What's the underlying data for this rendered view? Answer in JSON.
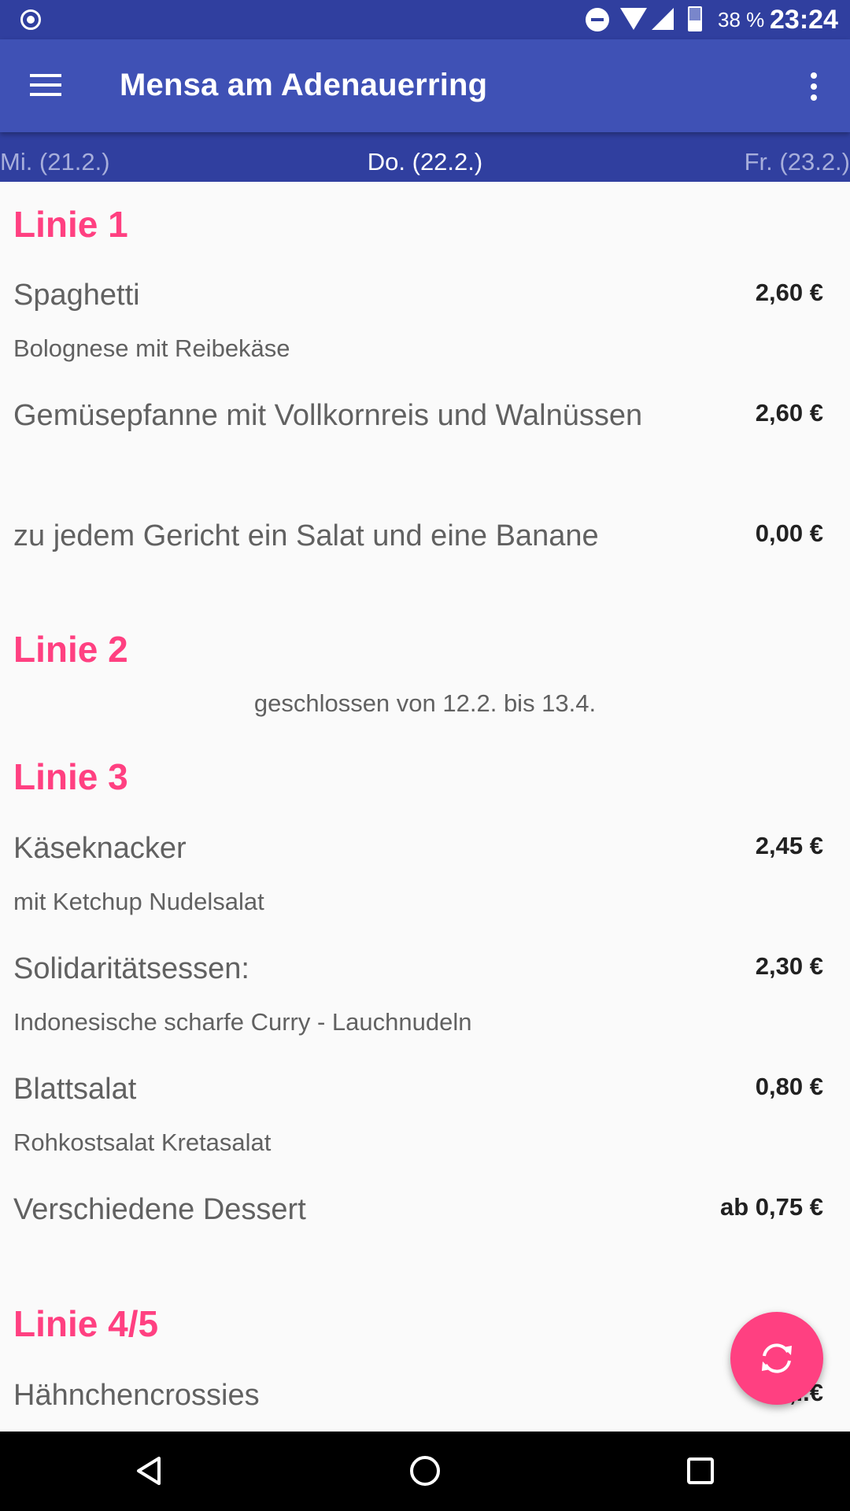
{
  "statusbar": {
    "battery": "38 %",
    "time": "23:24",
    "icons": [
      "record-icon",
      "do-not-disturb-icon",
      "wifi-icon",
      "signal-icon",
      "battery-icon"
    ]
  },
  "appbar": {
    "title": "Mensa am Adenauerring",
    "menu_icon": "hamburger-menu-icon",
    "overflow_icon": "more-vert-icon"
  },
  "days": {
    "prev": "Mi. (21.2.)",
    "current": "Do. (22.2.)",
    "next": "Fr. (23.2.)"
  },
  "lines": [
    {
      "title": "Linie 1",
      "meals": [
        {
          "name": "Spaghetti",
          "desc": "Bolognese mit Reibekäse",
          "price": "2,60 €"
        },
        {
          "name": "Gemüsepfanne mit Vollkornreis und Walnüssen",
          "desc": "",
          "price": "2,60 €"
        },
        {
          "name": "zu jedem Gericht ein Salat und eine Banane",
          "desc": "",
          "price": "0,00 €"
        }
      ]
    },
    {
      "title": "Linie 2",
      "note": "geschlossen von 12.2. bis 13.4."
    },
    {
      "title": "Linie 3",
      "meals": [
        {
          "name": "Käseknacker",
          "desc": "mit Ketchup Nudelsalat",
          "price": "2,45 €"
        },
        {
          "name": "Solidaritätsessen:",
          "desc": "Indonesische scharfe Curry - Lauchnudeln",
          "price": "2,30 €"
        },
        {
          "name": "Blattsalat",
          "desc": "Rohkostsalat Kretasalat",
          "price": "0,80 €"
        },
        {
          "name": "Verschiedene Dessert",
          "desc": "",
          "price": "ab 0,75 €"
        }
      ]
    },
    {
      "title": "Linie 4/5",
      "meals": [
        {
          "name": "Hähnchencrossies",
          "desc": "",
          "price": "2,..€"
        }
      ]
    }
  ],
  "fab": {
    "icon": "refresh-sync-icon"
  },
  "navbar": {
    "icons": [
      "back-icon",
      "home-icon",
      "recents-icon"
    ]
  },
  "colors": {
    "statusbar": "#303f9f",
    "appbar": "#3f51b5",
    "accent": "#ff4081",
    "background": "#fafafa"
  }
}
